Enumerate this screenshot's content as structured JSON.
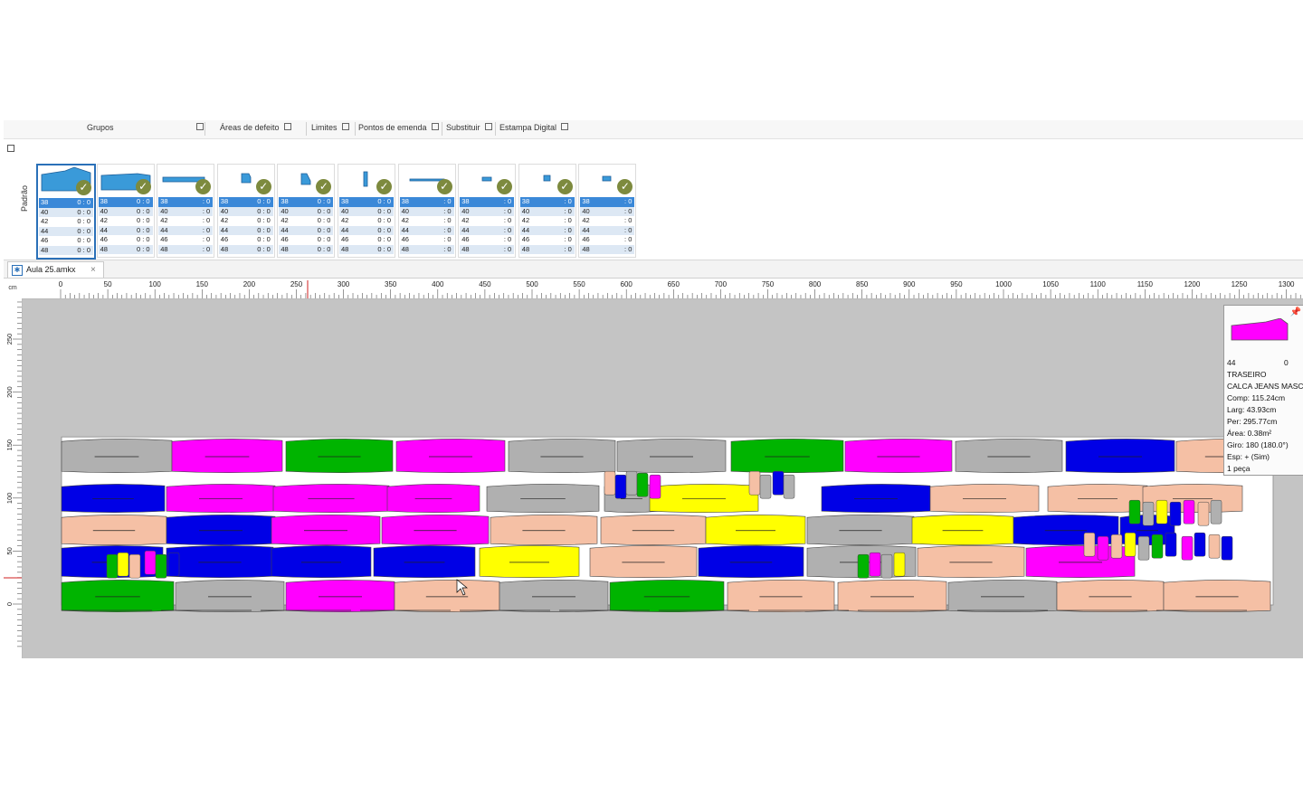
{
  "ribbon": {
    "groups": [
      {
        "label": "Grupos"
      },
      {
        "label": "Áreas de defeito"
      },
      {
        "label": "Limites"
      },
      {
        "label": "Pontos de emenda"
      },
      {
        "label": "Substituir"
      },
      {
        "label": "Estampa Digital"
      }
    ]
  },
  "panel": {
    "vertical_label": "Padrão",
    "cards": [
      {
        "icon": "piece-back-large-icon",
        "rows": [
          [
            "38",
            "0 : 0"
          ],
          [
            "40",
            "0 : 0"
          ],
          [
            "42",
            "0 : 0"
          ],
          [
            "44",
            "0 : 0"
          ],
          [
            "46",
            "0 : 0"
          ],
          [
            "48",
            "0 : 0"
          ]
        ]
      },
      {
        "icon": "piece-front-large-icon",
        "rows": [
          [
            "38",
            "0 : 0"
          ],
          [
            "40",
            "0 : 0"
          ],
          [
            "42",
            "0 : 0"
          ],
          [
            "44",
            "0 : 0"
          ],
          [
            "46",
            "0 : 0"
          ],
          [
            "48",
            "0 : 0"
          ]
        ]
      },
      {
        "icon": "piece-waistband-icon",
        "rows": [
          [
            "38",
            ": 0"
          ],
          [
            "40",
            ": 0"
          ],
          [
            "42",
            ": 0"
          ],
          [
            "44",
            ": 0"
          ],
          [
            "46",
            ": 0"
          ],
          [
            "48",
            ": 0"
          ]
        ]
      },
      {
        "icon": "piece-pocket-icon",
        "rows": [
          [
            "38",
            "0 : 0"
          ],
          [
            "40",
            "0 : 0"
          ],
          [
            "42",
            "0 : 0"
          ],
          [
            "44",
            "0 : 0"
          ],
          [
            "46",
            "0 : 0"
          ],
          [
            "48",
            "0 : 0"
          ]
        ]
      },
      {
        "icon": "piece-pocket-facing-icon",
        "rows": [
          [
            "38",
            "0 : 0"
          ],
          [
            "40",
            "0 : 0"
          ],
          [
            "42",
            "0 : 0"
          ],
          [
            "44",
            "0 : 0"
          ],
          [
            "46",
            "0 : 0"
          ],
          [
            "48",
            "0 : 0"
          ]
        ]
      },
      {
        "icon": "piece-fly-icon",
        "rows": [
          [
            "38",
            "0 : 0"
          ],
          [
            "40",
            "0 : 0"
          ],
          [
            "42",
            "0 : 0"
          ],
          [
            "44",
            "0 : 0"
          ],
          [
            "46",
            "0 : 0"
          ],
          [
            "48",
            "0 : 0"
          ]
        ]
      },
      {
        "icon": "piece-strip-icon",
        "rows": [
          [
            "38",
            ": 0"
          ],
          [
            "40",
            ": 0"
          ],
          [
            "42",
            ": 0"
          ],
          [
            "44",
            ": 0"
          ],
          [
            "46",
            ": 0"
          ],
          [
            "48",
            ": 0"
          ]
        ]
      },
      {
        "icon": "piece-loop-icon",
        "rows": [
          [
            "38",
            ": 0"
          ],
          [
            "40",
            ": 0"
          ],
          [
            "42",
            ": 0"
          ],
          [
            "44",
            ": 0"
          ],
          [
            "46",
            ": 0"
          ],
          [
            "48",
            ": 0"
          ]
        ]
      },
      {
        "icon": "piece-small-square-icon",
        "rows": [
          [
            "38",
            ": 0"
          ],
          [
            "40",
            ": 0"
          ],
          [
            "42",
            ": 0"
          ],
          [
            "44",
            ": 0"
          ],
          [
            "46",
            ": 0"
          ],
          [
            "48",
            ": 0"
          ]
        ]
      },
      {
        "icon": "piece-label-icon",
        "rows": [
          [
            "38",
            ": 0"
          ],
          [
            "40",
            ": 0"
          ],
          [
            "42",
            ": 0"
          ],
          [
            "44",
            ": 0"
          ],
          [
            "46",
            ": 0"
          ],
          [
            "48",
            ": 0"
          ]
        ]
      }
    ]
  },
  "document": {
    "tab_title": "Aula 25.amkx",
    "unit": "cm",
    "ruler_top_ticks": [
      0,
      50,
      100,
      150,
      200,
      250,
      300,
      350,
      400,
      450,
      500,
      550,
      600,
      650,
      700,
      750,
      800,
      850,
      900,
      950,
      1000,
      1050,
      1100,
      1150,
      1200,
      1250,
      1300
    ],
    "ruler_left_ticks": [
      0,
      50,
      100,
      150,
      200,
      250
    ],
    "marker_length_cm": 1285,
    "marker_width_cm": 163
  },
  "tooltip": {
    "size": "44",
    "quantity": "0",
    "piece_name": "TRASEIRO",
    "model": "CALCA JEANS MASC",
    "comp": "Comp: 115.24cm",
    "larg": "Larg: 43.93cm",
    "per": "Per: 295.77cm",
    "area": "Área: 0.38m²",
    "giro": "Giro: 180  (180.0°)",
    "esp": "Esp: +  (Sim)",
    "pieces": "1 peça"
  },
  "colors": {
    "magenta": "#ff00ff",
    "green": "#00b400",
    "blue": "#0000e6",
    "yellow": "#ffff00",
    "salmon": "#f5c0a5",
    "gray": "#b0b0b0",
    "canvas": "#c4c4c4",
    "accent": "#3a88d8"
  }
}
